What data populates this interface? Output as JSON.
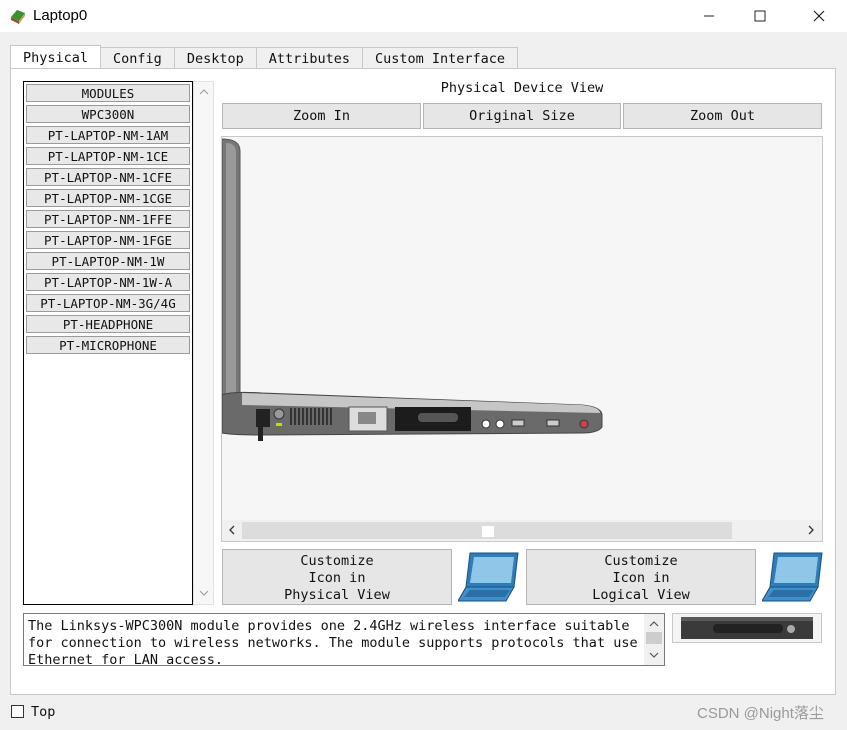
{
  "window": {
    "title": "Laptop0",
    "controls": {
      "minimize": "minimize-icon",
      "maximize": "maximize-icon",
      "close": "close-icon"
    }
  },
  "tabs": [
    {
      "label": "Physical",
      "active": true
    },
    {
      "label": "Config",
      "active": false
    },
    {
      "label": "Desktop",
      "active": false
    },
    {
      "label": "Attributes",
      "active": false
    },
    {
      "label": "Custom Interface",
      "active": false
    }
  ],
  "modules": {
    "items": [
      "MODULES",
      "WPC300N",
      "PT-LAPTOP-NM-1AM",
      "PT-LAPTOP-NM-1CE",
      "PT-LAPTOP-NM-1CFE",
      "PT-LAPTOP-NM-1CGE",
      "PT-LAPTOP-NM-1FFE",
      "PT-LAPTOP-NM-1FGE",
      "PT-LAPTOP-NM-1W",
      "PT-LAPTOP-NM-1W-A",
      "PT-LAPTOP-NM-3G/4G",
      "PT-HEADPHONE",
      "PT-MICROPHONE"
    ]
  },
  "physical_view": {
    "label": "Physical Device View",
    "zoom_in": "Zoom In",
    "original_size": "Original Size",
    "zoom_out": "Zoom Out"
  },
  "customize": {
    "physical_line1": "Customize",
    "physical_line2": "Icon in",
    "physical_line3": "Physical View",
    "logical_line1": "Customize",
    "logical_line2": "Icon in",
    "logical_line3": "Logical View"
  },
  "description": "The Linksys-WPC300N module provides one 2.4GHz wireless interface suitable for connection to wireless networks. The module supports protocols that use Ethernet for LAN access.",
  "footer": {
    "top_label": "Top",
    "top_checked": false
  },
  "watermark": "CSDN @Night落尘"
}
